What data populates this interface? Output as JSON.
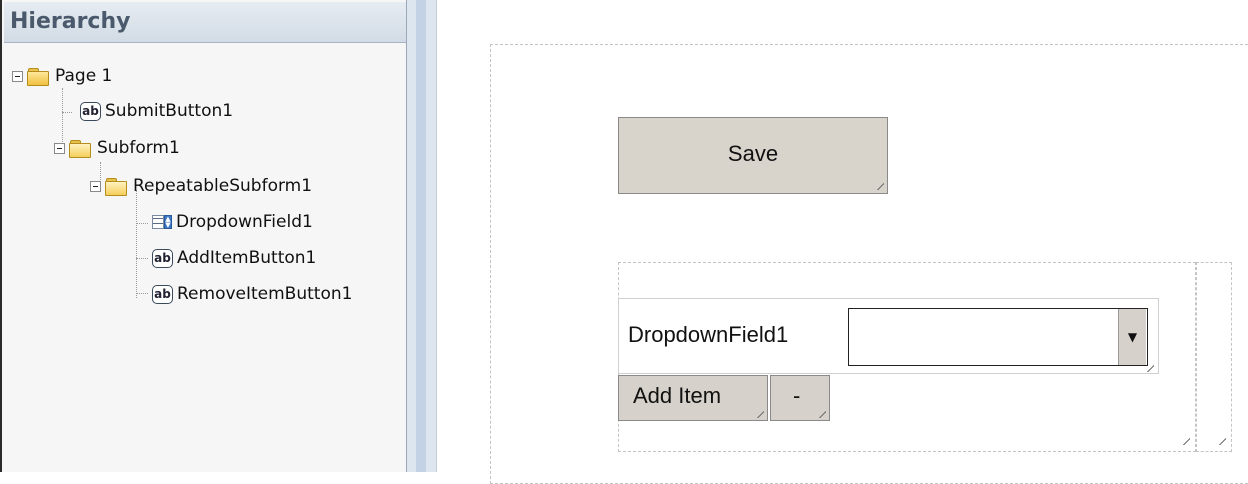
{
  "hierarchy": {
    "title": "Hierarchy",
    "items": [
      {
        "label": "Page 1",
        "icon": "folder-icon"
      },
      {
        "label": "SubmitButton1",
        "icon": "button-ab-icon"
      },
      {
        "label": "Subform1",
        "icon": "folder-open-icon"
      },
      {
        "label": "RepeatableSubform1",
        "icon": "folder-open-icon"
      },
      {
        "label": "DropdownField1",
        "icon": "dropdown-list-icon"
      },
      {
        "label": "AddItemButton1",
        "icon": "button-ab-icon"
      },
      {
        "label": "RemoveItemButton1",
        "icon": "button-ab-icon"
      }
    ],
    "ab_glyph": "ab"
  },
  "canvas": {
    "save_label": "Save",
    "dropdown_label": "DropdownField1",
    "dropdown_value": "",
    "add_item_label": "Add Item",
    "remove_item_label": "-"
  }
}
